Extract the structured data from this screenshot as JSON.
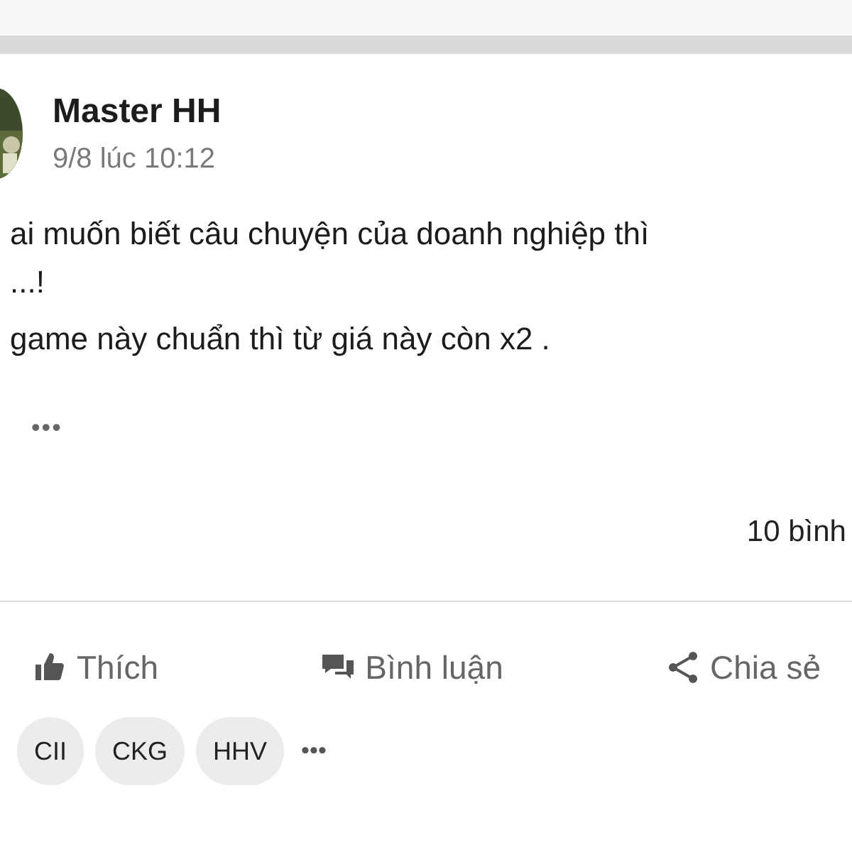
{
  "post": {
    "author": "Master HH",
    "time": "9/8 lúc 10:12",
    "lines": [
      "ai muốn biết câu chuyện của doanh nghiệp thì",
      "...!",
      "game này chuẩn thì từ giá này còn x2 ."
    ],
    "more": "•••",
    "comments_count": "10 bình"
  },
  "actions": [
    {
      "kind": "like",
      "label": "Thích"
    },
    {
      "kind": "comment",
      "label": "Bình luận"
    },
    {
      "kind": "share",
      "label": "Chia sẻ"
    }
  ],
  "tags": [
    "CII",
    "CKG",
    "HHV"
  ],
  "tags_more": "•••"
}
